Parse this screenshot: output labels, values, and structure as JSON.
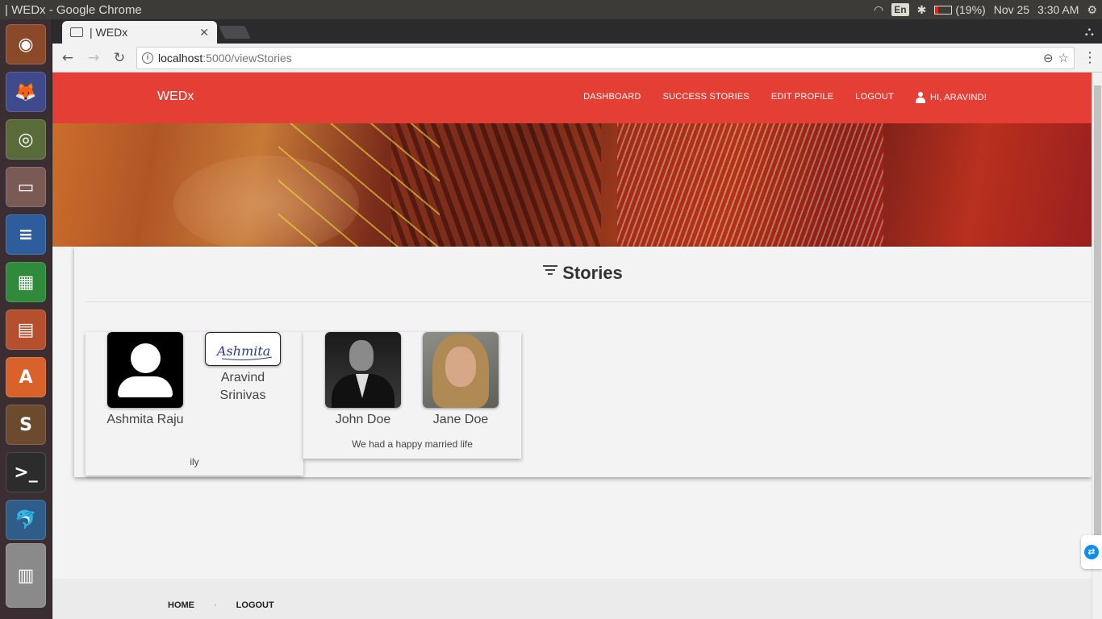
{
  "os": {
    "window_title": "| WEDx - Google Chrome",
    "lang": "En",
    "battery": "(19%)",
    "battery_level": 0.19,
    "date": "Nov 25",
    "time": "3:30 AM"
  },
  "browser": {
    "tab_title": "| WEDx",
    "url_host": "localhost",
    "url_rest": ":5000/viewStories"
  },
  "site": {
    "brand": "WEDx",
    "nav": {
      "dashboard": "DASHBOARD",
      "success_stories": "SUCCESS STORIES",
      "edit_profile": "EDIT PROFILE",
      "logout": "LOGOUT",
      "user_greeting": "HI, ARAVIND!"
    },
    "colors": {
      "navbar": "#e53f35"
    }
  },
  "stories": {
    "heading": "Stories",
    "items": [
      {
        "partner1": "Ashmita Raju",
        "partner2": "Aravind Srinivas",
        "partner2_signature": "Ashmita",
        "caption": "ily"
      },
      {
        "partner1": "John Doe",
        "partner2": "Jane Doe",
        "caption": "We had a happy married life"
      }
    ]
  },
  "footer": {
    "home": "HOME",
    "separator": "·",
    "logout": "LOGOUT"
  },
  "launcher": [
    "ubuntu-dash-icon",
    "firefox-icon",
    "chrome-icon",
    "files-icon",
    "writer-icon",
    "calc-icon",
    "impress-icon",
    "software-center-icon",
    "sublime-icon",
    "terminal-icon",
    "mysql-workbench-icon",
    "stacked-apps-icon"
  ]
}
